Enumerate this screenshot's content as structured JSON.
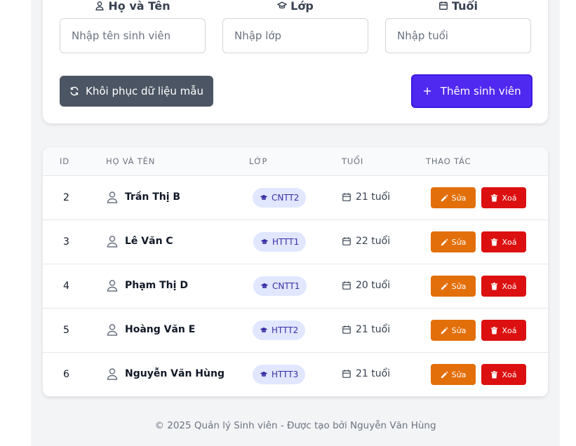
{
  "form": {
    "fields": [
      {
        "label": "Họ và Tên",
        "placeholder": "Nhập tên sinh viên",
        "icon": "user-icon"
      },
      {
        "label": "Lớp",
        "placeholder": "Nhập lớp",
        "icon": "graduation-cap-icon"
      },
      {
        "label": "Tuổi",
        "placeholder": "Nhập tuổi",
        "icon": "calendar-icon"
      }
    ],
    "reset_label": "Khôi phục dữ liệu mẫu",
    "add_label": "Thêm sinh viên"
  },
  "table": {
    "headers": {
      "id": "ID",
      "name": "Họ và tên",
      "class": "Lớp",
      "age": "Tuổi",
      "actions": "Thao tác"
    },
    "rows": [
      {
        "id": "2",
        "name": "Trần Thị B",
        "class": "CNTT2",
        "age": "21 tuổi"
      },
      {
        "id": "3",
        "name": "Lê Văn C",
        "class": "HTTT1",
        "age": "22 tuổi"
      },
      {
        "id": "4",
        "name": "Phạm Thị D",
        "class": "CNTT1",
        "age": "20 tuổi"
      },
      {
        "id": "5",
        "name": "Hoàng Văn E",
        "class": "HTTT2",
        "age": "21 tuổi"
      },
      {
        "id": "6",
        "name": "Nguyễn Văn Hùng",
        "class": "HTTT3",
        "age": "21 tuổi"
      }
    ],
    "edit_label": "Sửa",
    "delete_label": "Xoá"
  },
  "footer": {
    "text": "© 2025 Quản lý Sinh viên - Được tạo bởi Nguyễn Văn Hùng"
  },
  "colors": {
    "primary": "#4f29f0",
    "reset": "#4b5563",
    "edit": "#e36f0a",
    "delete": "#dc1010",
    "badge_bg": "#e0e7ff",
    "badge_text": "#3730a3"
  }
}
